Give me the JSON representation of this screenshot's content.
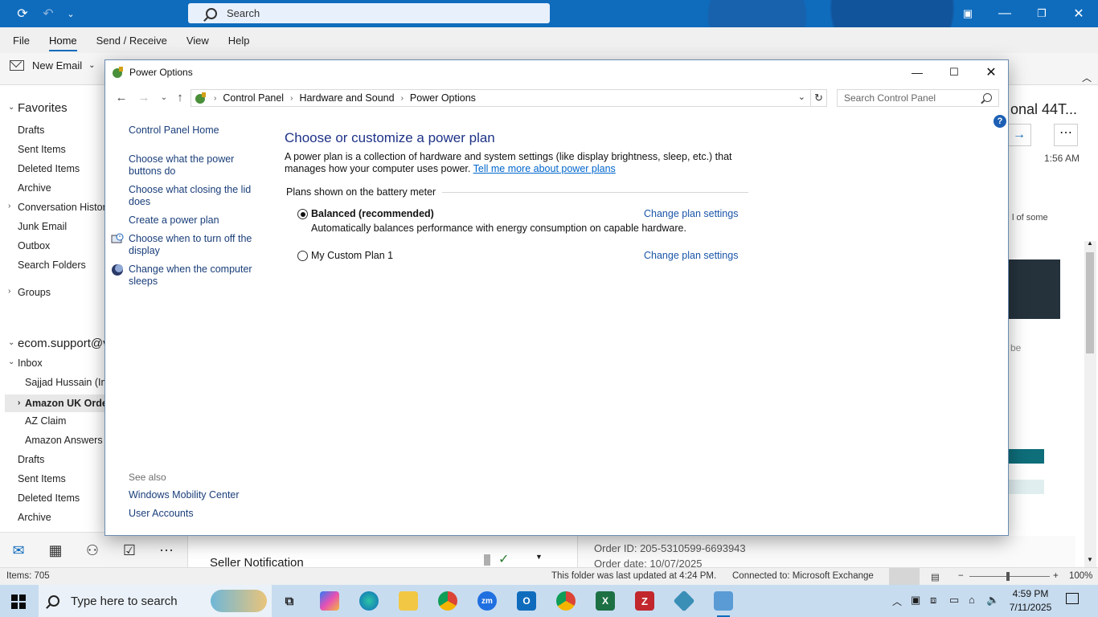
{
  "outlook": {
    "search_placeholder": "Search",
    "menu": [
      "File",
      "Home",
      "Send / Receive",
      "View",
      "Help"
    ],
    "new_email": "New Email",
    "favorites_header": "Favorites",
    "favorites": [
      "Drafts",
      "Sent Items",
      "Deleted Items",
      "Archive",
      "Conversation History",
      "Junk Email",
      "Outbox",
      "Search Folders"
    ],
    "groups": "Groups",
    "account": "ecom.support@v",
    "inbox": "Inbox",
    "inbox_sub": [
      "Sajjad Hussain (Imp",
      "Amazon UK Order",
      "AZ Claim",
      "Amazon Answers"
    ],
    "account_folders": [
      "Drafts",
      "Sent Items",
      "Deleted Items",
      "Archive"
    ],
    "list_subject": "Seller Notification",
    "reading": {
      "title_fragment": "onal 44T...",
      "time": "1:56 AM",
      "snippet1": "l of some",
      "snippet2": "be",
      "order_id": "Order ID: 205-5310599-6693943",
      "order_date": "Order date: 10/07/2025"
    },
    "status": {
      "items": "Items: 705",
      "updated": "This folder was last updated at 4:24 PM.",
      "connection": "Connected to: Microsoft Exchange",
      "zoom": "100%"
    }
  },
  "taskbar": {
    "search_placeholder": "Type here to search",
    "time": "4:59 PM",
    "date": "7/11/2025",
    "apps": [
      "task-view",
      "copilot",
      "edge",
      "file-explorer",
      "chrome",
      "zoom",
      "outlook",
      "chrome-profile",
      "excel",
      "filezilla",
      "app-blue",
      "control-panel"
    ]
  },
  "power_options": {
    "window_title": "Power Options",
    "breadcrumb": [
      "Control Panel",
      "Hardware and Sound",
      "Power Options"
    ],
    "search_placeholder": "Search Control Panel",
    "left_links": {
      "home": "Control Panel Home",
      "power_buttons": "Choose what the power buttons do",
      "lid": "Choose what closing the lid does",
      "create_plan": "Create a power plan",
      "display_off": "Choose when to turn off the display",
      "sleep": "Change when the computer sleeps"
    },
    "see_also": {
      "label": "See also",
      "items": [
        "Windows Mobility Center",
        "User Accounts"
      ]
    },
    "heading": "Choose or customize a power plan",
    "description": "A power plan is a collection of hardware and system settings (like display brightness, sleep, etc.) that manages how your computer uses power.",
    "learn_more": "Tell me more about power plans",
    "section_label": "Plans shown on the battery meter",
    "plans": [
      {
        "name": "Balanced (recommended)",
        "selected": true,
        "link": "Change plan settings",
        "description": "Automatically balances performance with energy consumption on capable hardware."
      },
      {
        "name": "My Custom Plan 1",
        "selected": false,
        "link": "Change plan settings",
        "description": ""
      }
    ]
  }
}
